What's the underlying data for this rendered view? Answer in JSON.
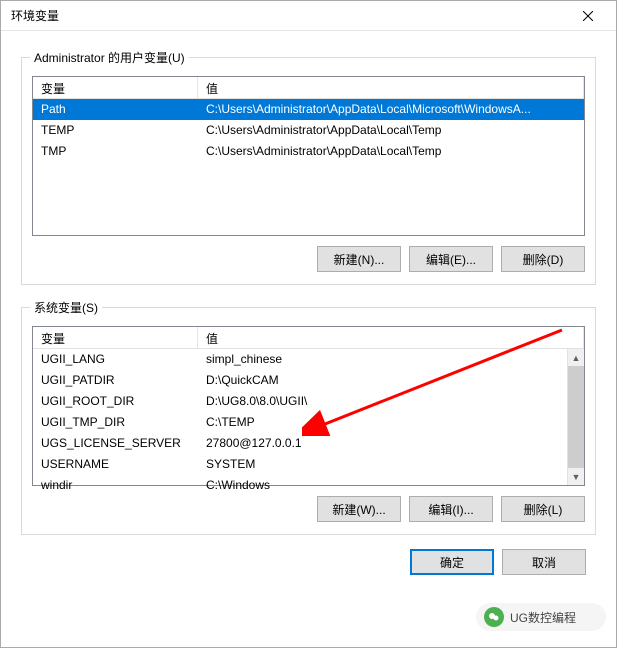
{
  "window": {
    "title": "环境变量"
  },
  "user_group": {
    "label": "Administrator 的用户变量(U)",
    "headers": {
      "name": "变量",
      "value": "值"
    },
    "rows": [
      {
        "name": "Path",
        "value": "C:\\Users\\Administrator\\AppData\\Local\\Microsoft\\WindowsA..."
      },
      {
        "name": "TEMP",
        "value": "C:\\Users\\Administrator\\AppData\\Local\\Temp"
      },
      {
        "name": "TMP",
        "value": "C:\\Users\\Administrator\\AppData\\Local\\Temp"
      }
    ],
    "buttons": {
      "new": "新建(N)...",
      "edit": "编辑(E)...",
      "delete": "删除(D)"
    }
  },
  "sys_group": {
    "label": "系统变量(S)",
    "headers": {
      "name": "变量",
      "value": "值"
    },
    "rows": [
      {
        "name": "UGII_LANG",
        "value": "simpl_chinese"
      },
      {
        "name": "UGII_PATDIR",
        "value": "D:\\QuickCAM"
      },
      {
        "name": "UGII_ROOT_DIR",
        "value": "D:\\UG8.0\\8.0\\UGII\\"
      },
      {
        "name": "UGII_TMP_DIR",
        "value": "C:\\TEMP"
      },
      {
        "name": "UGS_LICENSE_SERVER",
        "value": "27800@127.0.0.1"
      },
      {
        "name": "USERNAME",
        "value": "SYSTEM"
      },
      {
        "name": "windir",
        "value": "C:\\Windows"
      }
    ],
    "buttons": {
      "new": "新建(W)...",
      "edit": "编辑(I)...",
      "delete": "删除(L)"
    }
  },
  "main_buttons": {
    "ok": "确定",
    "cancel": "取消"
  },
  "watermark": {
    "text": "UG数控编程"
  }
}
